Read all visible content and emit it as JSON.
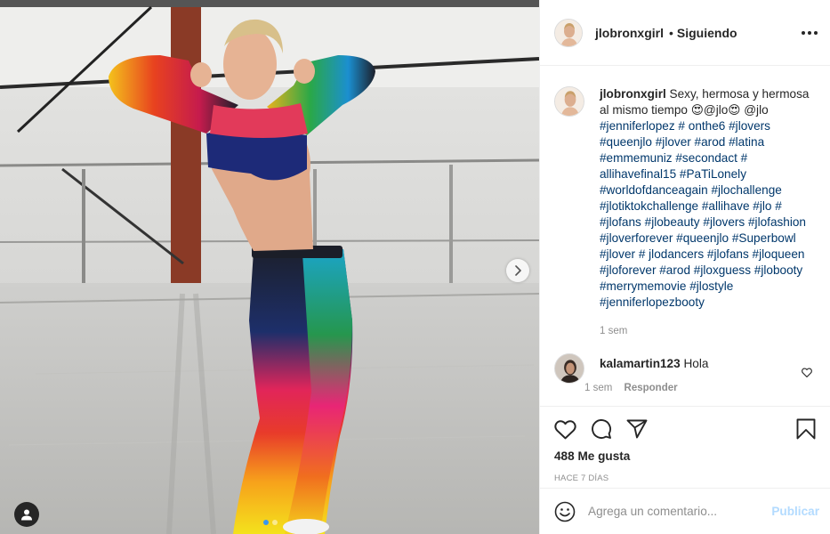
{
  "post": {
    "username": "jlobronxgirl",
    "separator": "•",
    "follow_status": "Siguiendo",
    "caption_text": "Sexy, hermosa y hermosa al mismo tiempo 😍@jlo😍 @jlo",
    "hashtags": "#jenniferlopez # onthe6 #jlovers #queenjlo #jlover #arod #latina #emmemuniz #secondact # allihavefinal15 #PaTiLonely #worldofdanceagain #jlochallenge #jlotiktokchallenge #allihave #jlo # #jlofans #jlobeauty #jlovers #jlofashion #jloverforever #queenjlo #Superbowl #jlover # jlodancers #jlofans #jloqueen #jloforever #arod #jloxguess #jlobooty #merrymemovie #jlostyle #jenniferlopezbooty",
    "caption_time": "1 sem"
  },
  "comments": [
    {
      "username": "kalamartin123",
      "text": "Hola",
      "time": "1 sem",
      "reply_label": "Responder"
    }
  ],
  "actions": {
    "likes": "488 Me gusta",
    "posted_ago": "HACE 7 DÍAS"
  },
  "add_comment": {
    "placeholder": "Agrega un comentario...",
    "post_label": "Publicar"
  },
  "icons": {
    "more": "more-options-icon",
    "like": "heart-icon",
    "comment": "comment-icon",
    "share": "paper-plane-icon",
    "save": "bookmark-icon",
    "emoji": "emoji-icon",
    "next": "chevron-right-icon",
    "tag": "user-tag-icon"
  },
  "colors": {
    "link": "#00376b",
    "muted": "#8e8e8e",
    "publish_disabled": "#b3dbff",
    "carousel_active": "#3897f0"
  }
}
